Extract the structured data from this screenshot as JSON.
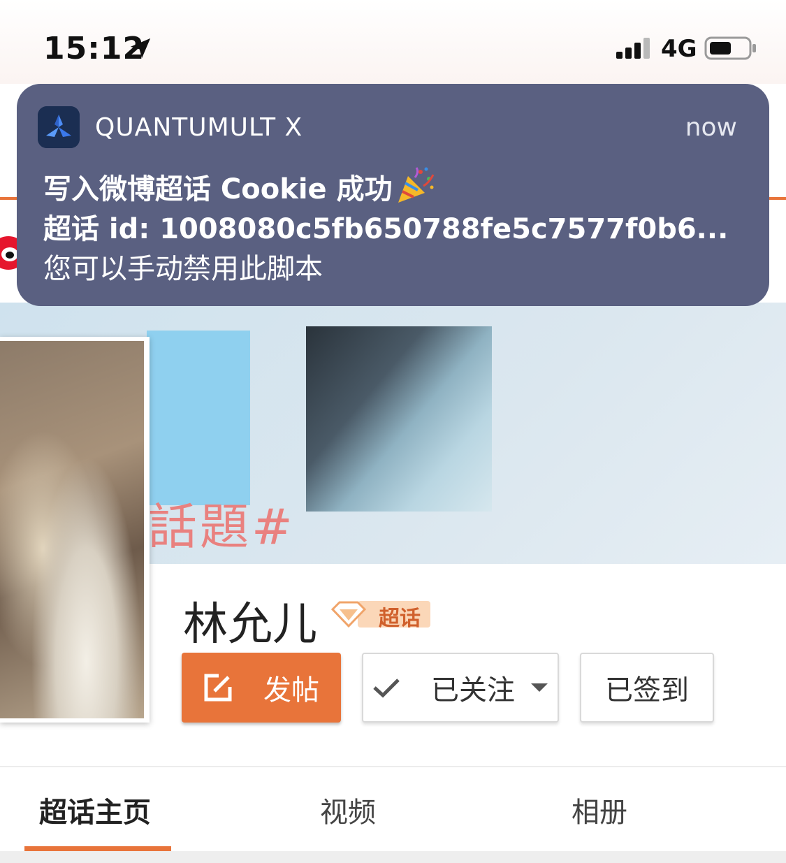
{
  "status_bar": {
    "time": "15:12",
    "network": "4G"
  },
  "notification": {
    "app_name": "QUANTUMULT X",
    "time": "now",
    "title": "写入微博超话 Cookie 成功",
    "subtitle": "超话 id: 1008080c5fb650788fe5c7577f0b6...",
    "body": "您可以手动禁用此脚本"
  },
  "banner": {
    "text": "話題#"
  },
  "topic": {
    "name": "林允儿",
    "badge": "超话"
  },
  "actions": {
    "post_label": "发帖",
    "follow_label": "已关注",
    "checkin_label": "已签到"
  },
  "tabs": [
    {
      "label": "超话主页"
    },
    {
      "label": "视频"
    },
    {
      "label": "相册"
    }
  ],
  "colors": {
    "accent": "#e8743a",
    "notification_bg": "#5a6081"
  }
}
